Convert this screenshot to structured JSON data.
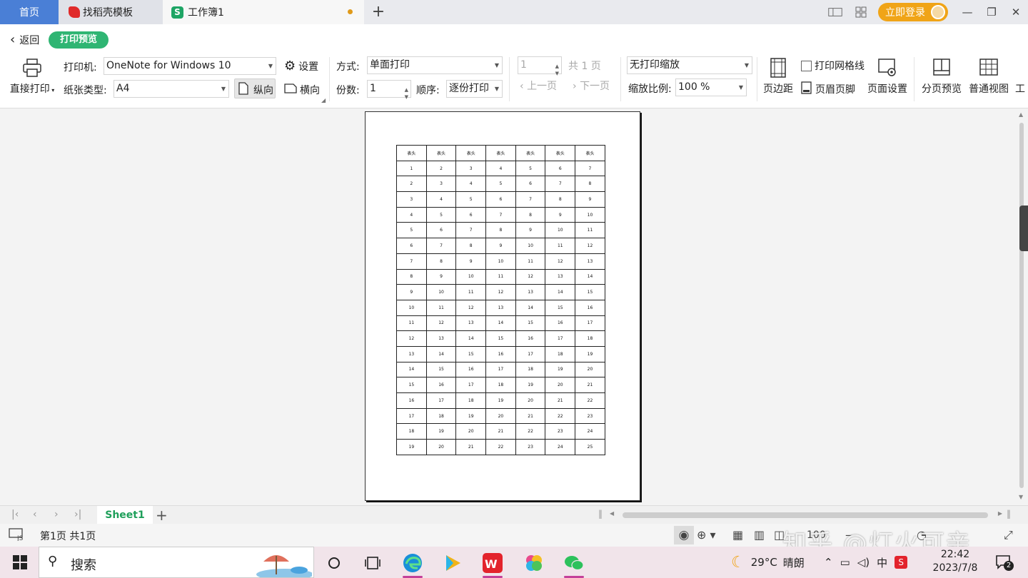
{
  "tabs": {
    "home": "首页",
    "template": "找稻壳模板",
    "workbook": "工作簿1",
    "add": "+"
  },
  "window": {
    "login": "立即登录",
    "layout_label": "1"
  },
  "backrow": {
    "back": "返回",
    "mode": "打印预览"
  },
  "ribbon": {
    "direct_print": "直接打印",
    "printer_label": "打印机:",
    "printer_value": "OneNote for Windows 10",
    "settings": "设置",
    "paper_label": "纸张类型:",
    "paper_value": "A4",
    "portrait": "纵向",
    "landscape": "横向",
    "method_label": "方式:",
    "method_value": "单面打印",
    "copies_label": "份数:",
    "copies_value": "1",
    "order_label": "顺序:",
    "order_value": "逐份打印",
    "page_value": "1",
    "total_pages": "共 1 页",
    "prev_page": "上一页",
    "next_page": "下一页",
    "scale_mode": "无打印缩放",
    "scale_label": "缩放比例:",
    "scale_value": "100 %",
    "margins": "页边距",
    "gridlines": "打印网格线",
    "header_footer": "页眉页脚",
    "page_setup": "页面设置",
    "page_break_preview": "分页预览",
    "normal_view": "普通视图",
    "overflow": "工"
  },
  "sheet": {
    "header": [
      "表头",
      "表头",
      "表头",
      "表头",
      "表头",
      "表头",
      "表头"
    ],
    "rows": [
      [
        "1",
        "2",
        "3",
        "4",
        "5",
        "6",
        "7"
      ],
      [
        "2",
        "3",
        "4",
        "5",
        "6",
        "7",
        "8"
      ],
      [
        "3",
        "4",
        "5",
        "6",
        "7",
        "8",
        "9"
      ],
      [
        "4",
        "5",
        "6",
        "7",
        "8",
        "9",
        "10"
      ],
      [
        "5",
        "6",
        "7",
        "8",
        "9",
        "10",
        "11"
      ],
      [
        "6",
        "7",
        "8",
        "9",
        "10",
        "11",
        "12"
      ],
      [
        "7",
        "8",
        "9",
        "10",
        "11",
        "12",
        "13"
      ],
      [
        "8",
        "9",
        "10",
        "11",
        "12",
        "13",
        "14"
      ],
      [
        "9",
        "10",
        "11",
        "12",
        "13",
        "14",
        "15"
      ],
      [
        "10",
        "11",
        "12",
        "13",
        "14",
        "15",
        "16"
      ],
      [
        "11",
        "12",
        "13",
        "14",
        "15",
        "16",
        "17"
      ],
      [
        "12",
        "13",
        "14",
        "15",
        "16",
        "17",
        "18"
      ],
      [
        "13",
        "14",
        "15",
        "16",
        "17",
        "18",
        "19"
      ],
      [
        "14",
        "15",
        "16",
        "17",
        "18",
        "19",
        "20"
      ],
      [
        "15",
        "16",
        "17",
        "18",
        "19",
        "20",
        "21"
      ],
      [
        "16",
        "17",
        "18",
        "19",
        "20",
        "21",
        "22"
      ],
      [
        "17",
        "18",
        "19",
        "20",
        "21",
        "22",
        "23"
      ],
      [
        "18",
        "19",
        "20",
        "21",
        "22",
        "23",
        "24"
      ],
      [
        "19",
        "20",
        "21",
        "22",
        "23",
        "24",
        "25"
      ]
    ]
  },
  "sheetbar": {
    "sheet_name": "Sheet1",
    "add": "+"
  },
  "status": {
    "page_info": "第1页 共1页",
    "zoom_partial": "100",
    "watermark": "知乎 @灯火可亲"
  },
  "taskbar": {
    "search": "搜索",
    "weather_temp": "29°C",
    "weather_text": "晴朗",
    "ime": "中",
    "time": "22:42",
    "date": "2023/7/8",
    "notif_count": "2"
  },
  "colors": {
    "accent_green": "#2fb573",
    "home_tab_blue": "#4a7fd6",
    "login_orange": "#f0a417"
  },
  "icons": [
    "printer-icon",
    "gear-icon",
    "portrait-page-icon",
    "landscape-page-icon",
    "margins-icon",
    "header-footer-icon",
    "page-setup-icon",
    "page-break-preview-icon",
    "normal-view-icon",
    "eye-icon",
    "windows-start-icon",
    "search-icon",
    "edge-icon",
    "wps-icon",
    "wechat-icon",
    "moon-icon"
  ]
}
